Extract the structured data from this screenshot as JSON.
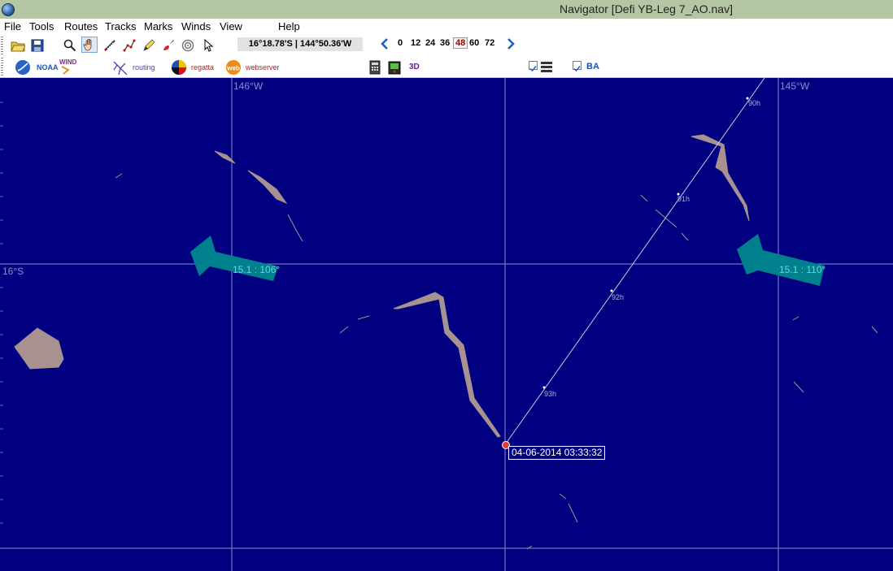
{
  "window": {
    "title": "Navigator [Defi YB-Leg 7_AO.nav]"
  },
  "menu": [
    "File",
    "Tools",
    "Routes",
    "Tracks",
    "Marks",
    "Winds",
    "View",
    "Help"
  ],
  "toolbar": {
    "cursor_position": "16°18.78'S | 144°50.36'W",
    "hours": [
      "0",
      "12",
      "24",
      "36",
      "48",
      "60",
      "72"
    ],
    "selected_hour": "48",
    "noaa_label": "NOAA",
    "wind_label": "WIND",
    "routing_label": "routing",
    "regatta_label": "regatta",
    "webserver_label": "webserver",
    "view_3d_label": "3D",
    "ba_label": "BA"
  },
  "map": {
    "lon_labels": [
      "146°W",
      "145°W"
    ],
    "lat_labels": [
      "16°S"
    ],
    "winds": [
      {
        "label": "15.1 : 106°"
      },
      {
        "label": "15.1 : 110°"
      }
    ],
    "route_hours": [
      "90h",
      "91h",
      "92h",
      "93h"
    ],
    "boat_timestamp": "04-06-2014 03:33:32"
  },
  "colors": {
    "sea": "#000080",
    "reef": "#a89191",
    "wind_arrow": "#00808c",
    "grid": "#8c8cc8",
    "route": "#c8c8e6"
  }
}
